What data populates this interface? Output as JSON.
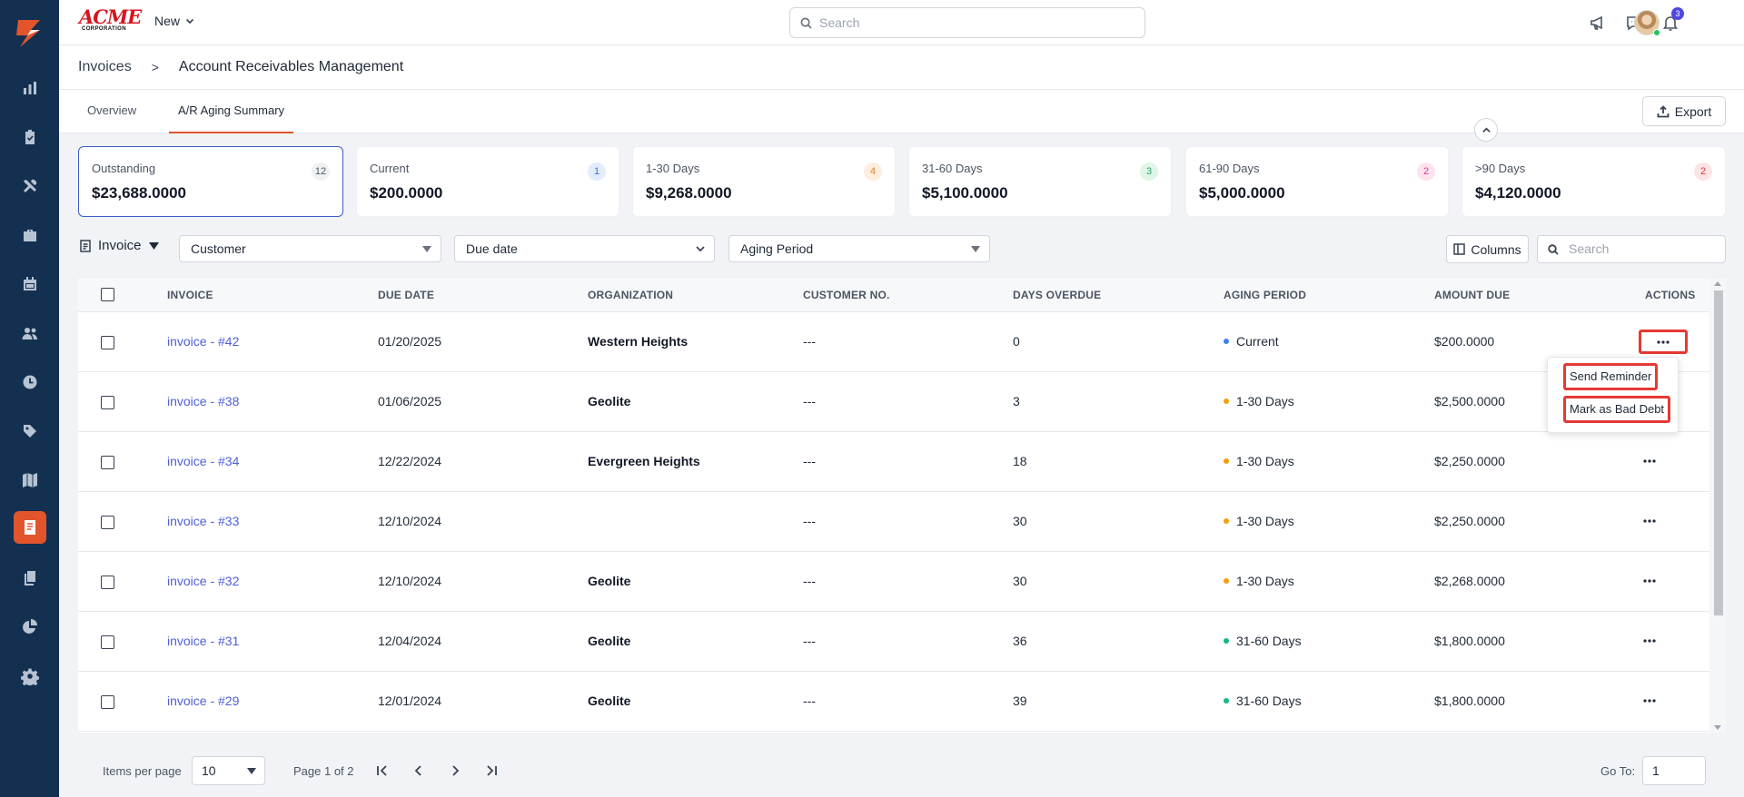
{
  "colors": {
    "sidebar_bg": "#133050",
    "accent": "#e2552c",
    "link": "#4f5fd6",
    "highlight_red": "#e53935",
    "current_dot": "#3b82f6",
    "days_1_30_dot": "#f59e0b",
    "days_31_60_dot": "#10b981"
  },
  "sidebar": {
    "items": [
      {
        "icon": "bar-chart-icon"
      },
      {
        "icon": "clipboard-check-icon"
      },
      {
        "icon": "tools-icon"
      },
      {
        "icon": "briefcase-icon"
      },
      {
        "icon": "calendar-icon"
      },
      {
        "icon": "users-icon"
      },
      {
        "icon": "clock-icon"
      },
      {
        "icon": "tag-icon"
      },
      {
        "icon": "map-icon"
      },
      {
        "icon": "invoice-icon",
        "active": true
      },
      {
        "icon": "documents-icon"
      },
      {
        "icon": "pie-chart-icon"
      },
      {
        "icon": "gear-icon"
      }
    ]
  },
  "topbar": {
    "brand_line1": "ACME",
    "brand_line2": "CORPORATION",
    "new_label": "New",
    "search_placeholder": "Search",
    "notification_count": "3"
  },
  "breadcrumb": {
    "parent": "Invoices",
    "separator": ">",
    "current": "Account Receivables Management"
  },
  "tabs": [
    {
      "label": "Overview",
      "active": false
    },
    {
      "label": "A/R Aging Summary",
      "active": true
    }
  ],
  "export_label": "Export",
  "summary_cards": [
    {
      "label": "Outstanding",
      "value": "$23,688.0000",
      "count": "12",
      "badge_bg": "#f0f1f3",
      "badge_fg": "#4b5563"
    },
    {
      "label": "Current",
      "value": "$200.0000",
      "count": "1",
      "badge_bg": "#e3ecfd",
      "badge_fg": "#3b6fd4"
    },
    {
      "label": "1-30 Days",
      "value": "$9,268.0000",
      "count": "4",
      "badge_bg": "#fdeedd",
      "badge_fg": "#d9822b"
    },
    {
      "label": "31-60 Days",
      "value": "$5,100.0000",
      "count": "3",
      "badge_bg": "#def5e8",
      "badge_fg": "#2f9e62"
    },
    {
      "label": "61-90 Days",
      "value": "$5,000.0000",
      "count": "2",
      "badge_bg": "#fde3ef",
      "badge_fg": "#d6408a"
    },
    {
      "label": ">90 Days",
      "value": "$4,120.0000",
      "count": "2",
      "badge_bg": "#fde4e4",
      "badge_fg": "#d63b3b"
    }
  ],
  "filters": {
    "type_label": "Invoice",
    "customer": "Customer",
    "due_date": "Due date",
    "aging_period": "Aging Period",
    "columns_label": "Columns",
    "search_placeholder": "Search"
  },
  "table": {
    "headers": [
      "INVOICE",
      "DUE DATE",
      "ORGANIZATION",
      "CUSTOMER NO.",
      "DAYS OVERDUE",
      "AGING PERIOD",
      "AMOUNT DUE",
      "ACTIONS"
    ],
    "rows": [
      {
        "invoice": "invoice - #42",
        "due": "01/20/2025",
        "org": "Western Heights",
        "cust": "---",
        "days": "0",
        "period": "Current",
        "amount": "$200.0000"
      },
      {
        "invoice": "invoice - #38",
        "due": "01/06/2025",
        "org": "Geolite",
        "cust": "---",
        "days": "3",
        "period": "1-30 Days",
        "amount": "$2,500.0000"
      },
      {
        "invoice": "invoice - #34",
        "due": "12/22/2024",
        "org": "Evergreen Heights",
        "cust": "---",
        "days": "18",
        "period": "1-30 Days",
        "amount": "$2,250.0000"
      },
      {
        "invoice": "invoice - #33",
        "due": "12/10/2024",
        "org": "",
        "cust": "---",
        "days": "30",
        "period": "1-30 Days",
        "amount": "$2,250.0000"
      },
      {
        "invoice": "invoice - #32",
        "due": "12/10/2024",
        "org": "Geolite",
        "cust": "---",
        "days": "30",
        "period": "1-30 Days",
        "amount": "$2,268.0000"
      },
      {
        "invoice": "invoice - #31",
        "due": "12/04/2024",
        "org": "Geolite",
        "cust": "---",
        "days": "36",
        "period": "31-60 Days",
        "amount": "$1,800.0000"
      },
      {
        "invoice": "invoice - #29",
        "due": "12/01/2024",
        "org": "Geolite",
        "cust": "---",
        "days": "39",
        "period": "31-60 Days",
        "amount": "$1,800.0000"
      }
    ]
  },
  "action_menu": {
    "send_reminder": "Send Reminder",
    "mark_bad_debt": "Mark as Bad Debt"
  },
  "footer": {
    "items_per_page_label": "Items per page",
    "items_per_page_value": "10",
    "page_info": "Page 1 of 2",
    "goto_label": "Go To:",
    "goto_value": "1"
  }
}
